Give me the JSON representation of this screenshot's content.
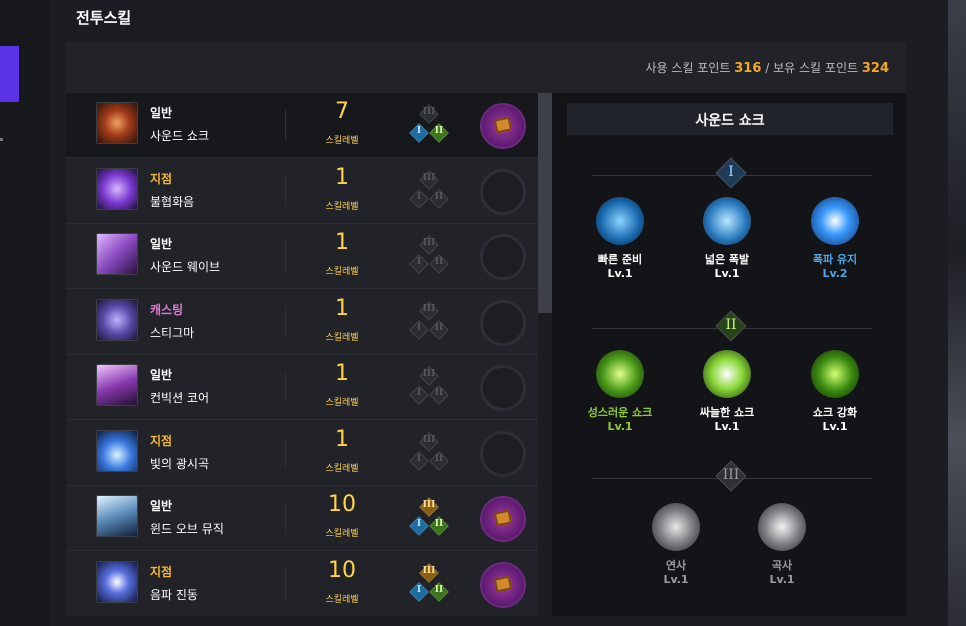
{
  "header": {
    "title": "전투스킬"
  },
  "points": {
    "used_label": "사용 스킬 포인트",
    "used_value": "316",
    "separator": "/",
    "owned_label": "보유 스킬 포인트",
    "owned_value": "324"
  },
  "skills": [
    {
      "type": "일반",
      "type_color": "#ffffff",
      "name": "사운드 쇼크",
      "level": "7",
      "level_label": "스킬레벨",
      "tripods": [
        "on3dim",
        "on1",
        "on2"
      ],
      "gem": "filled"
    },
    {
      "type": "지점",
      "type_color": "#f5b82e",
      "name": "불협화음",
      "level": "1",
      "level_label": "스킬레벨",
      "tripods": [
        "off",
        "off",
        "off"
      ],
      "gem": "empty"
    },
    {
      "type": "일반",
      "type_color": "#ffffff",
      "name": "사운드 웨이브",
      "level": "1",
      "level_label": "스킬레벨",
      "tripods": [
        "off",
        "off",
        "off"
      ],
      "gem": "empty"
    },
    {
      "type": "캐스팅",
      "type_color": "#e07ad6",
      "name": "스티그마",
      "level": "1",
      "level_label": "스킬레벨",
      "tripods": [
        "off",
        "off",
        "off"
      ],
      "gem": "empty"
    },
    {
      "type": "일반",
      "type_color": "#ffffff",
      "name": "컨빅션 코어",
      "level": "1",
      "level_label": "스킬레벨",
      "tripods": [
        "off",
        "off",
        "off"
      ],
      "gem": "empty"
    },
    {
      "type": "지점",
      "type_color": "#f5b82e",
      "name": "빛의 광시곡",
      "level": "1",
      "level_label": "스킬레벨",
      "tripods": [
        "off",
        "off",
        "off"
      ],
      "gem": "empty"
    },
    {
      "type": "일반",
      "type_color": "#ffffff",
      "name": "윈드 오브 뮤직",
      "level": "10",
      "level_label": "스킬레벨",
      "tripods": [
        "on3",
        "on1",
        "on2"
      ],
      "gem": "filled"
    },
    {
      "type": "지점",
      "type_color": "#f5b82e",
      "name": "음파 진동",
      "level": "10",
      "level_label": "스킬레벨",
      "tripods": [
        "on3",
        "on1",
        "on2"
      ],
      "gem": "filled"
    }
  ],
  "tier_numerals": {
    "t1": "I",
    "t2": "II",
    "t3": "III"
  },
  "detail": {
    "title": "사운드 쇼크",
    "tier1": [
      {
        "name": "빠른 준비",
        "level": "Lv.1",
        "name_color": "#ffffff",
        "icon": "hourglass-icon"
      },
      {
        "name": "넓은 폭발",
        "level": "Lv.1",
        "name_color": "#ffffff",
        "icon": "expand-eye-icon"
      },
      {
        "name": "폭파 유지",
        "level": "Lv.2",
        "name_color": "#4fa6e8",
        "icon": "burst-icon"
      }
    ],
    "tier2": [
      {
        "name": "성스러운 쇼크",
        "level": "Lv.1",
        "name_color": "#8ecf2e",
        "icon": "holy-burst-icon"
      },
      {
        "name": "싸늘한 쇼크",
        "level": "Lv.1",
        "name_color": "#ffffff",
        "icon": "snowflake-icon"
      },
      {
        "name": "쇼크 강화",
        "level": "Lv.1",
        "name_color": "#ffffff",
        "icon": "staff-sparkle-icon"
      }
    ],
    "tier3": [
      {
        "name": "연사",
        "level": "Lv.1",
        "name_color": "#9a9ca0",
        "icon": "rapid-fire-icon"
      },
      {
        "name": "곡사",
        "level": "Lv.1",
        "name_color": "#9a9ca0",
        "icon": "arc-shot-icon"
      }
    ]
  }
}
